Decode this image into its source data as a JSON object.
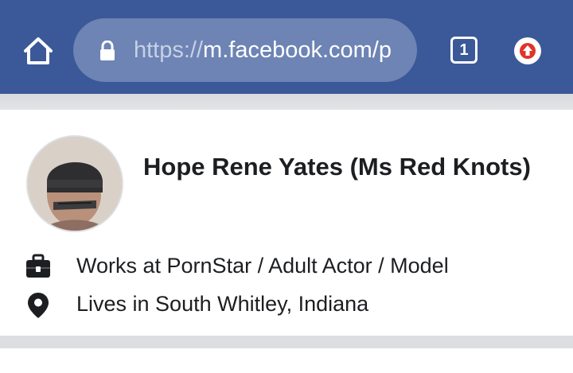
{
  "browser": {
    "url_scheme": "https://",
    "url_rest": "m.facebook.com/p",
    "tab_count": "1",
    "colors": {
      "toolbar": "#3b5998",
      "urlbar": "#6d84b4",
      "update_badge": "#e0352b"
    },
    "icons": {
      "home": "home-icon",
      "lock": "lock-icon",
      "tabs": "tabs-icon",
      "update": "update-arrow-icon"
    }
  },
  "profile": {
    "name": "Hope Rene Yates (Ms Red Knots)",
    "work": "Works at PornStar / Adult Actor / Model",
    "location": "Lives in South Whitley, Indiana",
    "icons": {
      "work": "briefcase-icon",
      "location": "location-pin-icon"
    }
  }
}
